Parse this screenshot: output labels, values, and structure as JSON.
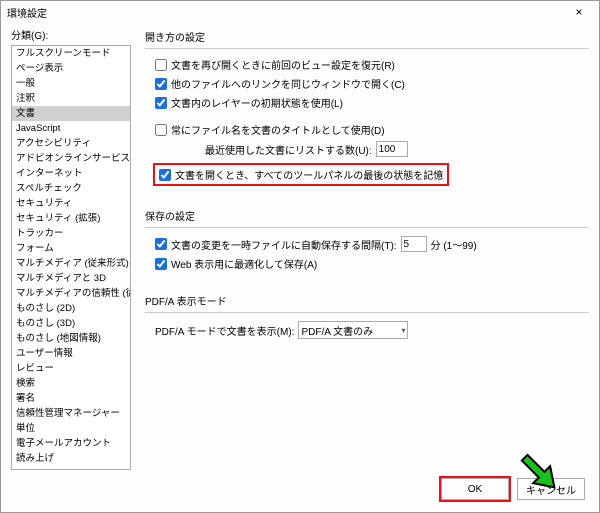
{
  "dialog": {
    "title": "環境設定"
  },
  "left": {
    "label": "分類(G):",
    "items": [
      "フルスクリーンモード",
      "ページ表示",
      "一般",
      "注釈",
      "文書",
      "JavaScript",
      "アクセシビリティ",
      "アドビオンラインサービス",
      "インターネット",
      "スペルチェック",
      "セキュリティ",
      "セキュリティ (拡張)",
      "トラッカー",
      "フォーム",
      "マルチメディア (従来形式)",
      "マルチメディアと 3D",
      "マルチメディアの信頼性 (従来形式)",
      "ものさし (2D)",
      "ものさし (3D)",
      "ものさし (地図情報)",
      "ユーザー情報",
      "レビュー",
      "検索",
      "署名",
      "信頼性管理マネージャー",
      "単位",
      "電子メールアカウント",
      "読み上げ"
    ],
    "selected_index": 4
  },
  "opening": {
    "title": "開き方の設定",
    "restore_view": {
      "checked": false,
      "label": "文書を再び開くときに前回のビュー設定を復元(R)"
    },
    "open_link_same_window": {
      "checked": true,
      "label": "他のファイルへのリンクを同じウィンドウで開く(C)"
    },
    "use_layer_initial": {
      "checked": true,
      "label": "文書内のレイヤーの初期状態を使用(L)"
    },
    "use_filename_title": {
      "checked": false,
      "label": "常にファイル名を文書のタイトルとして使用(D)"
    },
    "recent_label": "最近使用した文書にリストする数(U):",
    "recent_value": "100",
    "remember_panels": {
      "checked": true,
      "label": "文書を開くとき、すべてのツールパネルの最後の状態を記憶"
    }
  },
  "saving": {
    "title": "保存の設定",
    "autosave": {
      "checked": true,
      "label_pre": "文書の変更を一時ファイルに自動保存する間隔(T):",
      "value": "5",
      "label_post": "分 (1〜99)"
    },
    "optimize_web": {
      "checked": true,
      "label": "Web 表示用に最適化して保存(A)"
    }
  },
  "pdfa": {
    "title": "PDF/A 表示モード",
    "label": "PDF/A モードで文書を表示(M):",
    "value": "PDF/A 文書のみ"
  },
  "footer": {
    "ok": "OK",
    "cancel": "キャンセル"
  }
}
